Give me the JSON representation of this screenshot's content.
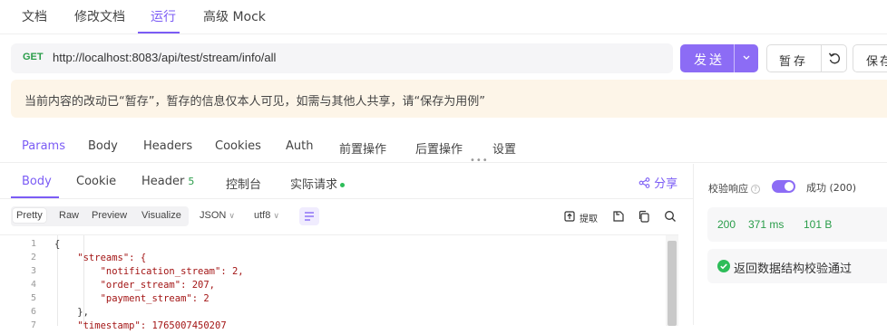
{
  "top_tabs": {
    "items": [
      {
        "label": "文档",
        "active": false
      },
      {
        "label": "修改文档",
        "active": false
      },
      {
        "label": "运行",
        "active": true
      },
      {
        "label": "高级 Mock",
        "active": false
      }
    ]
  },
  "request": {
    "method": "GET",
    "url": "http://localhost:8083/api/test/stream/info/all",
    "send_label": "发送",
    "stash_label": "暂存",
    "save_label": "保存"
  },
  "notice": {
    "text": "当前内容的改动已“暂存”，暂存的信息仅本人可见，如需与其他人共享，请“保存为用例”"
  },
  "request_tabs": {
    "items": [
      {
        "label": "Params",
        "active": true
      },
      {
        "label": "Body",
        "active": false
      },
      {
        "label": "Headers",
        "active": false
      },
      {
        "label": "Cookies",
        "active": false
      },
      {
        "label": "Auth",
        "active": false
      },
      {
        "label": "前置操作",
        "active": false
      },
      {
        "label": "后置操作",
        "active": false
      },
      {
        "label": "设置",
        "active": false
      }
    ],
    "drag_handle": "•••"
  },
  "response": {
    "tabs": [
      {
        "label": "Body",
        "active": true
      },
      {
        "label": "Cookie",
        "active": false
      },
      {
        "label": "Header",
        "badge": "5",
        "active": false
      },
      {
        "label": "控制台",
        "active": false
      },
      {
        "label": "实际请求",
        "dot": true,
        "active": false
      }
    ],
    "share_label": "分享",
    "formats": [
      "Pretty",
      "Raw",
      "Preview",
      "Visualize"
    ],
    "active_format": "Pretty",
    "type_select": "JSON",
    "encoding_select": "utf8",
    "extract_label": "提取",
    "code_lines": [
      {
        "n": "1",
        "text": "{"
      },
      {
        "n": "2",
        "text": "    \"streams\": {"
      },
      {
        "n": "3",
        "text": "        \"notification_stream\": 2,"
      },
      {
        "n": "4",
        "text": "        \"order_stream\": 207,"
      },
      {
        "n": "5",
        "text": "        \"payment_stream\": 2"
      },
      {
        "n": "6",
        "text": "    },"
      },
      {
        "n": "7",
        "text": "    \"timestamp\": 1765007450207"
      }
    ]
  },
  "side_panel": {
    "validate_label": "校验响应",
    "help_glyph": "?",
    "toggle_on": true,
    "toggle_text": "成功 (200)",
    "status_code": "200",
    "duration": "371 ms",
    "size": "101 B",
    "validation_result": "返回数据结构校验通过"
  },
  "colors": {
    "accent": "#7b5cf5",
    "send_bg": "#8c6cf5",
    "success": "#2a9d4a",
    "notice_bg": "#fdf5e8"
  }
}
